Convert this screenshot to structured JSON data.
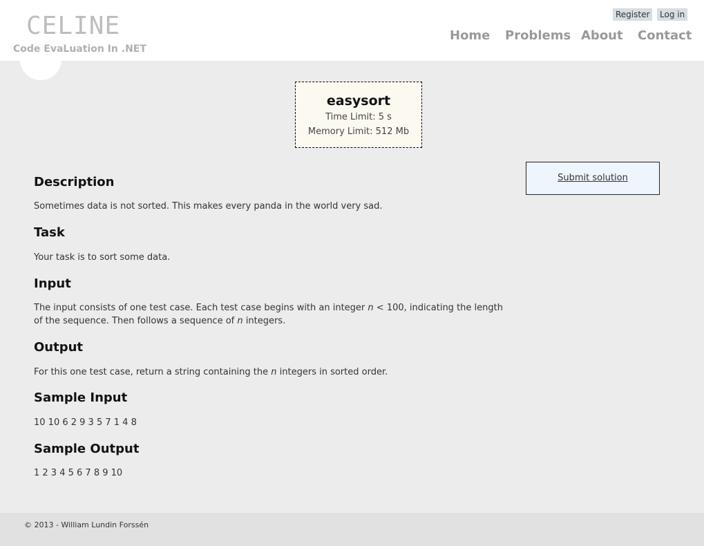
{
  "logo": {
    "title": "CELINE",
    "subtitle": "Code EvaLuation In .NET"
  },
  "auth": {
    "register": "Register",
    "login": "Log in"
  },
  "nav": {
    "home": "Home",
    "problems": "Problems",
    "about": "About",
    "contact": "Contact"
  },
  "problem": {
    "name": "easysort",
    "time_limit": "Time Limit: 5 s",
    "memory_limit": "Memory Limit: 512 Mb"
  },
  "submit": {
    "label": "Submit solution"
  },
  "sections": {
    "description": {
      "heading": "Description",
      "text": "Sometimes data is not sorted. This makes every panda in the world very sad."
    },
    "task": {
      "heading": "Task",
      "text": "Your task is to sort some data."
    },
    "input": {
      "heading": "Input",
      "t1": "The input consists of one test case. Each test case begins with an integer ",
      "v1": "n",
      "t2": " < 100, indicating the length of the sequence. Then follows a sequence of ",
      "v2": "n",
      "t3": " integers."
    },
    "output": {
      "heading": "Output",
      "t1": "For this one test case, return a string containing the ",
      "v1": "n",
      "t2": " integers in sorted order."
    },
    "sample_input": {
      "heading": "Sample Input",
      "text": "10 10 6 2 9 3 5 7 1 4 8"
    },
    "sample_output": {
      "heading": "Sample Output",
      "text": "1 2 3 4 5 6 7 8 9 10"
    }
  },
  "footer": {
    "text": "© 2013 - William Lundin Forssén"
  }
}
